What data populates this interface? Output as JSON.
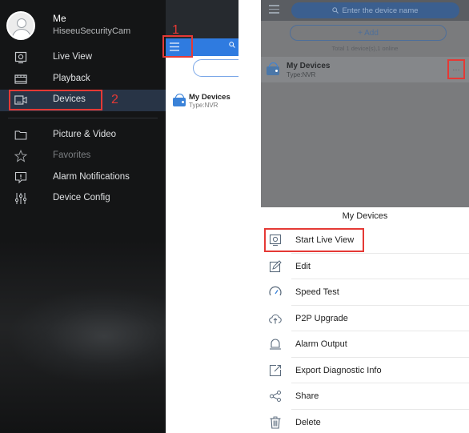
{
  "left_panel": {
    "profile": {
      "name": "Me",
      "account": "HiseeuSecurityCam"
    },
    "menu": [
      {
        "label": "Live View",
        "icon": "live-view-icon"
      },
      {
        "label": "Playback",
        "icon": "playback-icon"
      },
      {
        "label": "Devices",
        "icon": "devices-icon",
        "active": true
      },
      {
        "label": "Picture & Video",
        "icon": "folder-icon"
      },
      {
        "label": "Favorites",
        "icon": "star-icon"
      },
      {
        "label": "Alarm Notifications",
        "icon": "alarm-icon"
      },
      {
        "label": "Device Config",
        "icon": "sliders-icon"
      }
    ],
    "callouts": {
      "step1": "1",
      "step2": "2"
    },
    "peek": {
      "device_name": "My Devices",
      "device_type": "Type:NVR"
    }
  },
  "right_panel": {
    "search_placeholder": "Enter the device name",
    "add_label": "+ Add",
    "total_text": "Total 1 device(s),1 online",
    "device": {
      "name": "My Devices",
      "type": "Type:NVR"
    },
    "sheet": {
      "title": "My Devices",
      "items": [
        {
          "label": "Start Live View",
          "icon": "live-view-icon"
        },
        {
          "label": "Edit",
          "icon": "edit-icon"
        },
        {
          "label": "Speed Test",
          "icon": "speedometer-icon"
        },
        {
          "label": "P2P Upgrade",
          "icon": "cloud-upload-icon"
        },
        {
          "label": "Alarm Output",
          "icon": "alarm-output-icon"
        },
        {
          "label": "Export Diagnostic Info",
          "icon": "export-icon"
        },
        {
          "label": "Share",
          "icon": "share-icon"
        },
        {
          "label": "Delete",
          "icon": "trash-icon"
        }
      ]
    }
  },
  "colors": {
    "highlight": "#e53935",
    "accent": "#2f7be0",
    "drawer_bg": "#1d1f21",
    "active_item": "#283446"
  }
}
